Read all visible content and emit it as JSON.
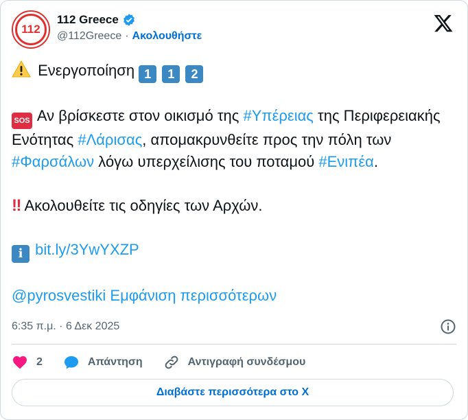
{
  "account": {
    "display_name": "112 Greece",
    "handle": "@112Greece",
    "separator": "·",
    "follow_label": "Ακολουθήστε",
    "avatar_text": "112"
  },
  "tweet": {
    "line1_text": "Ενεργοποίηση",
    "line1_badges": [
      "1",
      "1",
      "2"
    ],
    "para2": {
      "sos_label": "SOS",
      "t1": " Αν βρίσκεστε στον οικισμό της ",
      "h1": "#Υπέρειας",
      "t2": " της Περιφερειακής Ενότητας ",
      "h2": "#Λάρισας",
      "t3": ", απομακρυνθείτε προς την πόλη των ",
      "h3": "#Φαρσάλων",
      "t4": "  λόγω υπερχείλισης του ποταμού ",
      "h4": "#Ενιπέα",
      "t5": "."
    },
    "para3": {
      "bang": "‼",
      "text": "Ακολουθείτε τις οδηγίες των Αρχών."
    },
    "para4": {
      "info_badge": "i",
      "link": "bit.ly/3YwYXZP"
    },
    "para5": {
      "mention": "@pyrosvestiki",
      "show_more": "Εμφάνιση περισσότερων"
    }
  },
  "timestamp": "6:35 π.μ. · 6 Δεκ 2025",
  "actions": {
    "like_count": "2",
    "reply_label": "Απάντηση",
    "copy_link_label": "Αντιγραφή συνδέσμου"
  },
  "read_more_label": "Διαβάστε περισσότερα στο X",
  "colors": {
    "link": "#1d9bf0",
    "follow": "#006fd6",
    "like": "#f91880",
    "reply": "#1d9bf0",
    "brand_red": "#e0312f"
  }
}
